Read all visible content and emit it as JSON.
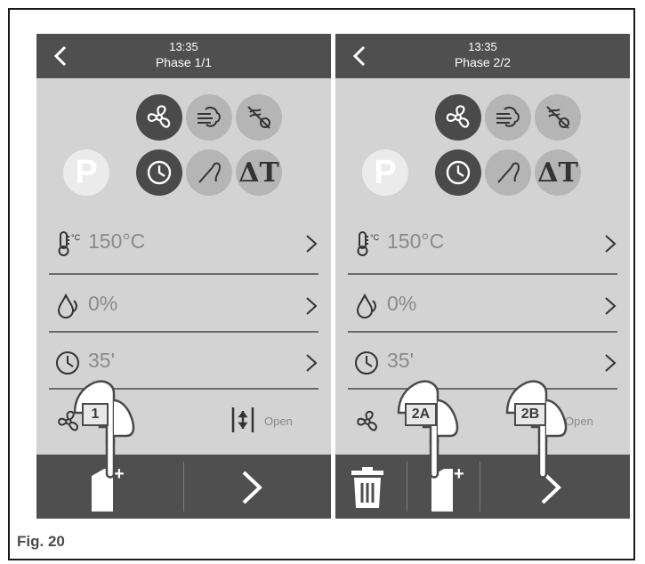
{
  "figure_label": "Fig. 20",
  "screens": [
    {
      "header": {
        "time": "13:35",
        "phase": "Phase 1/1"
      },
      "rows": {
        "temperature": "150°C",
        "humidity": "0%",
        "time": "35'",
        "vent_status": "Open"
      },
      "callouts": [
        "1"
      ]
    },
    {
      "header": {
        "time": "13:35",
        "phase": "Phase 2/2"
      },
      "rows": {
        "temperature": "150°C",
        "humidity": "0%",
        "time": "35'",
        "vent_status": "Open"
      },
      "callouts": [
        "2A",
        "2B"
      ]
    }
  ],
  "buttons": {
    "p_label": "P"
  },
  "colors": {
    "header": "#4f4f4f",
    "screen_bg": "#d3d3d3",
    "active": "#4a4a4a",
    "inactive": "#b5b5b5"
  }
}
